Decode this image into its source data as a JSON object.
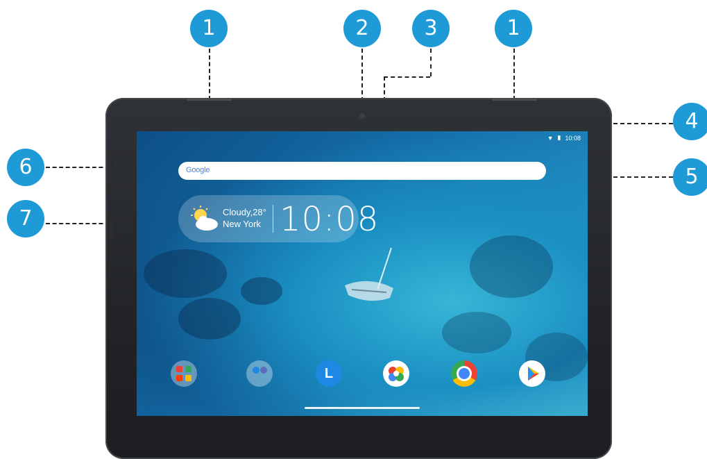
{
  "callouts": {
    "c1a": "1",
    "c2": "2",
    "c3": "3",
    "c1b": "1",
    "c4": "4",
    "c5": "5",
    "c6": "6",
    "c7": "7"
  },
  "screen": {
    "status_time": "10:08",
    "search_logo": "Google",
    "weather_line1": "Cloudy,28°",
    "weather_line2": "New York",
    "clock": "10:08",
    "dock_icons": [
      "apps-folder-icon",
      "folder-icon",
      "lenovo-launcher-icon",
      "photos-icon",
      "chrome-icon",
      "play-store-icon"
    ],
    "launcher_letter": "L"
  },
  "colors": {
    "callout": "#1e9ad6",
    "bezel": "#2a2c30",
    "water_deep": "#0d4f86",
    "water_light": "#2aa3cf"
  }
}
